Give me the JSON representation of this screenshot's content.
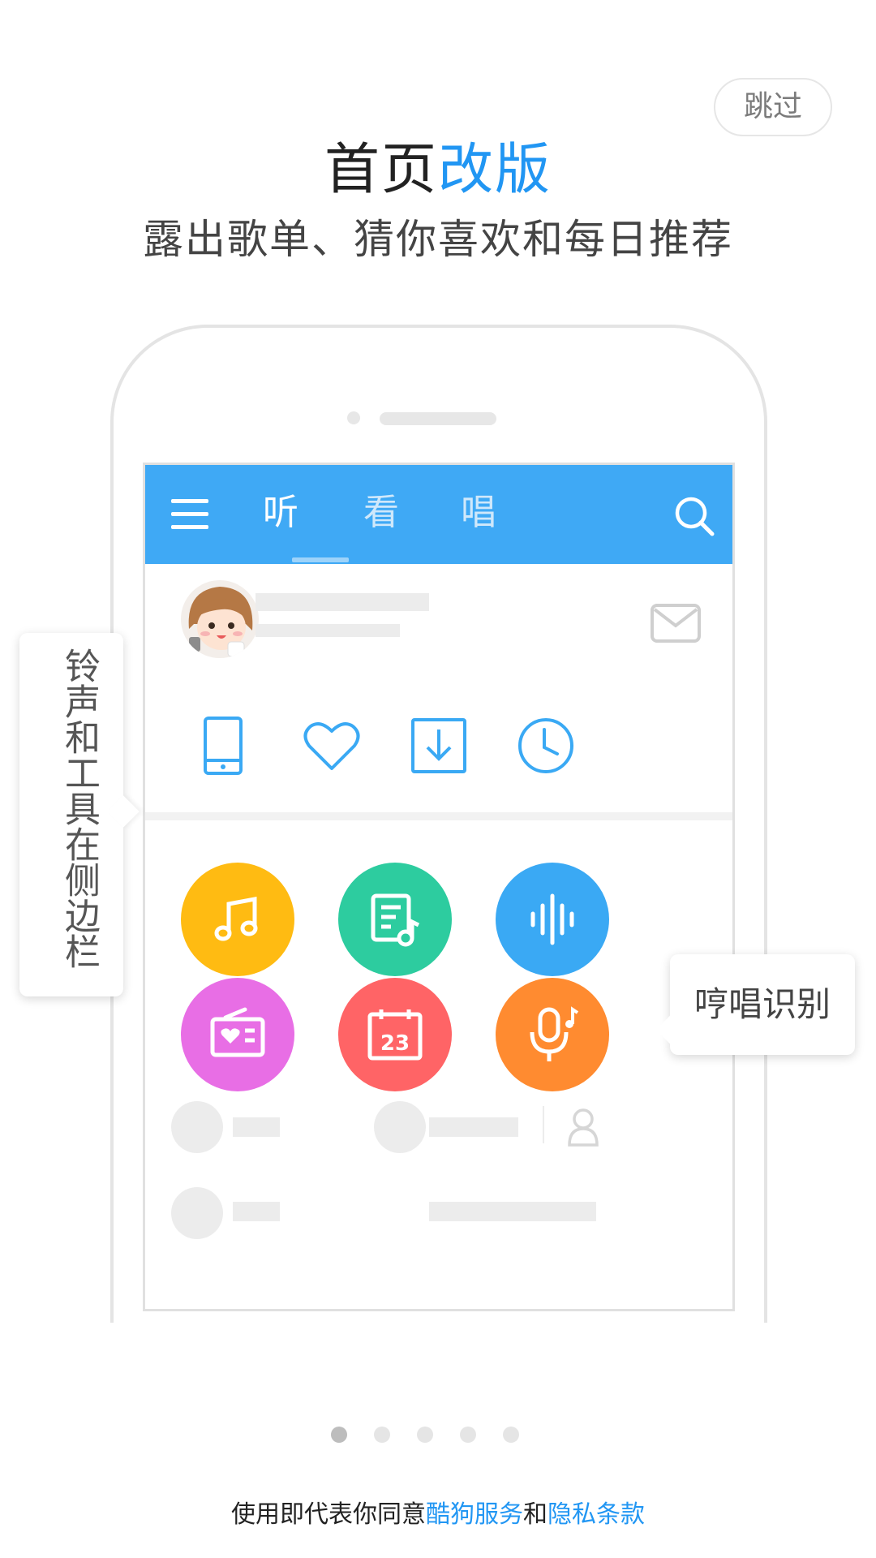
{
  "skip_label": "跳过",
  "heading": {
    "part1": "首页",
    "part2": "改版",
    "accent_color": "#2196f3"
  },
  "subheading": "露出歌单、猜你喜欢和每日推荐",
  "app_preview": {
    "topbar_color": "#3fa9f5",
    "menu_icon": "menu-icon",
    "tabs": [
      {
        "label": "听",
        "active": true
      },
      {
        "label": "看",
        "active": false
      },
      {
        "label": "唱",
        "active": false
      }
    ],
    "search_icon": "search-icon",
    "mail_icon": "mail-icon",
    "quick_icons": [
      "phone-icon",
      "heart-icon",
      "download-icon",
      "clock-icon"
    ],
    "feature_icons": [
      {
        "icon": "music-note-icon",
        "color": "#ffbb12"
      },
      {
        "icon": "playlist-icon",
        "color": "#2dcc9f"
      },
      {
        "icon": "sound-wave-icon",
        "color": "#3aa9f4"
      },
      {
        "icon": "radio-icon",
        "color": "#e86ee5"
      },
      {
        "icon": "calendar-icon",
        "color": "#ff6466"
      },
      {
        "icon": "microphone-icon",
        "color": "#ff8b30"
      }
    ],
    "calendar_day": "23",
    "person_icon": "person-icon"
  },
  "tooltips": {
    "sidebar": "铃声和工具在侧边栏",
    "humming": "哼唱识别"
  },
  "pagination": {
    "count": 5,
    "active_index": 0
  },
  "terms": {
    "prefix": "使用即代表你同意",
    "service_link": "酷狗服务",
    "joiner": "和",
    "privacy_link": "隐私条款",
    "link_color": "#2196f3"
  }
}
